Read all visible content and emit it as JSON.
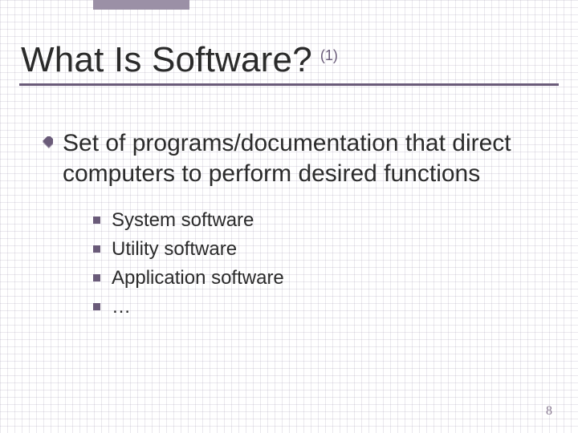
{
  "title": {
    "text": "What Is Software?",
    "suffix": "(1)"
  },
  "bullets": {
    "level1": "Set of programs/documentation that direct computers to perform desired functions",
    "level2": [
      "System software",
      "Utility software",
      "Application software",
      "…"
    ]
  },
  "page_number": "8",
  "colors": {
    "accent": "#6a5b79",
    "accent_light": "#9b90a6"
  }
}
